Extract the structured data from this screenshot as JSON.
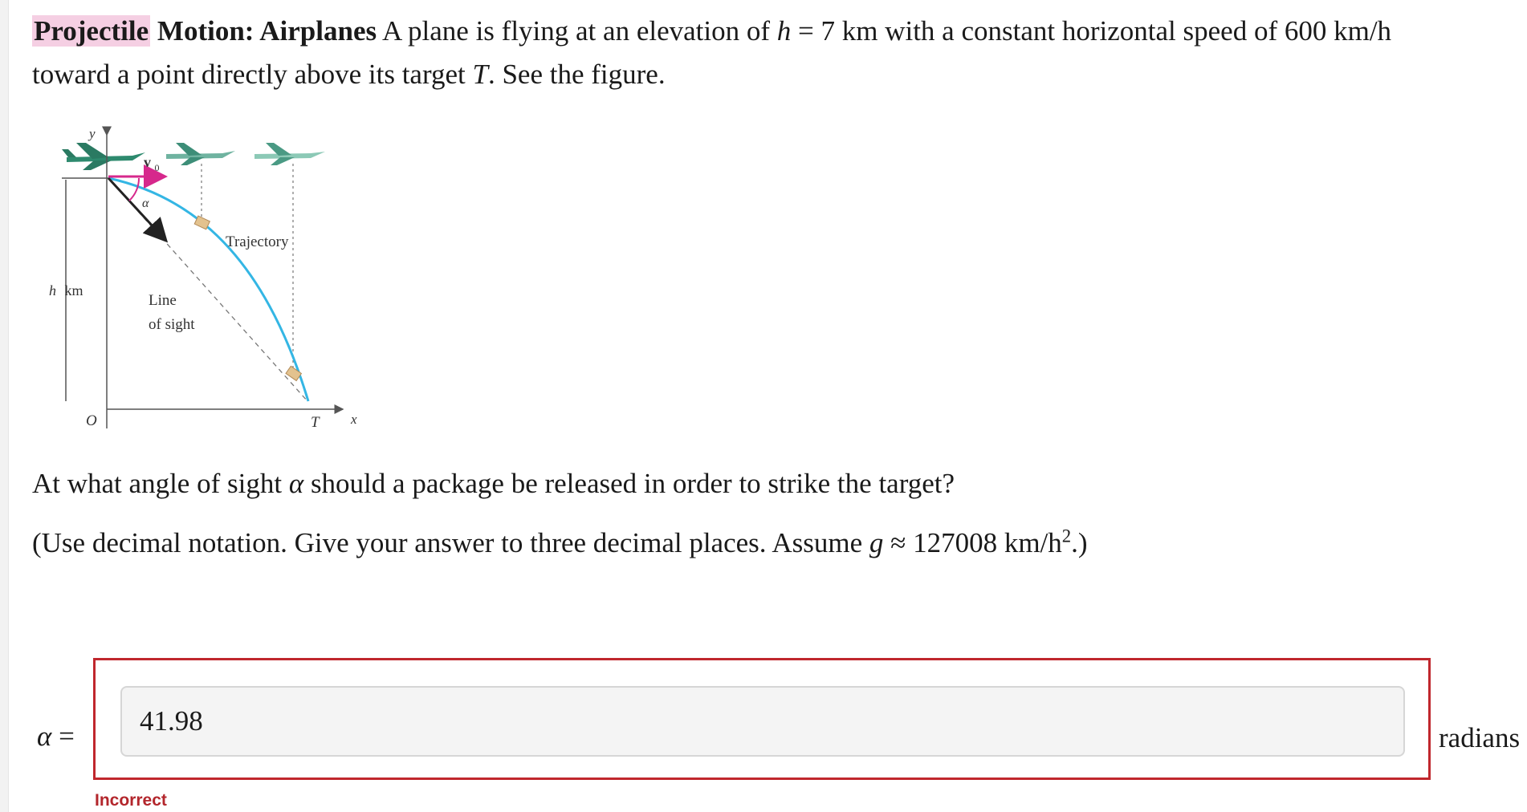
{
  "problem": {
    "title_highlight": "Projectile",
    "title_rest": "Motion: Airplanes",
    "text_1": "A plane is flying at an elevation of",
    "var_h": "h",
    "eq_1": " = 7 km with a constant horizontal speed of 600 km/h",
    "text_2": "toward a point directly above its target",
    "var_T": "T",
    "text_3": ". See the figure."
  },
  "figure": {
    "y_axis": "y",
    "x_axis": "x",
    "origin": "O",
    "target": "T",
    "velocity": "v",
    "velocity_sub": "0",
    "angle": "α",
    "trajectory": "Trajectory",
    "height_var": "h",
    "height_unit": "km",
    "line_of_sight_1": "Line",
    "line_of_sight_2": "of sight"
  },
  "question": {
    "text_1": "At what angle of sight",
    "var_alpha": "α",
    "text_2": "should a package be released in order to strike the target?"
  },
  "instruction": {
    "text_1": "(Use decimal notation. Give your answer to three decimal places. Assume",
    "var_g": "g",
    "text_2": " ≈ 127008 km/h",
    "exp": "2",
    "text_3": ".)"
  },
  "answer": {
    "label_var": "α",
    "label_eq": " =",
    "value": "41.98",
    "unit": "radians",
    "feedback": "Incorrect",
    "status_color": "#c0272d"
  }
}
